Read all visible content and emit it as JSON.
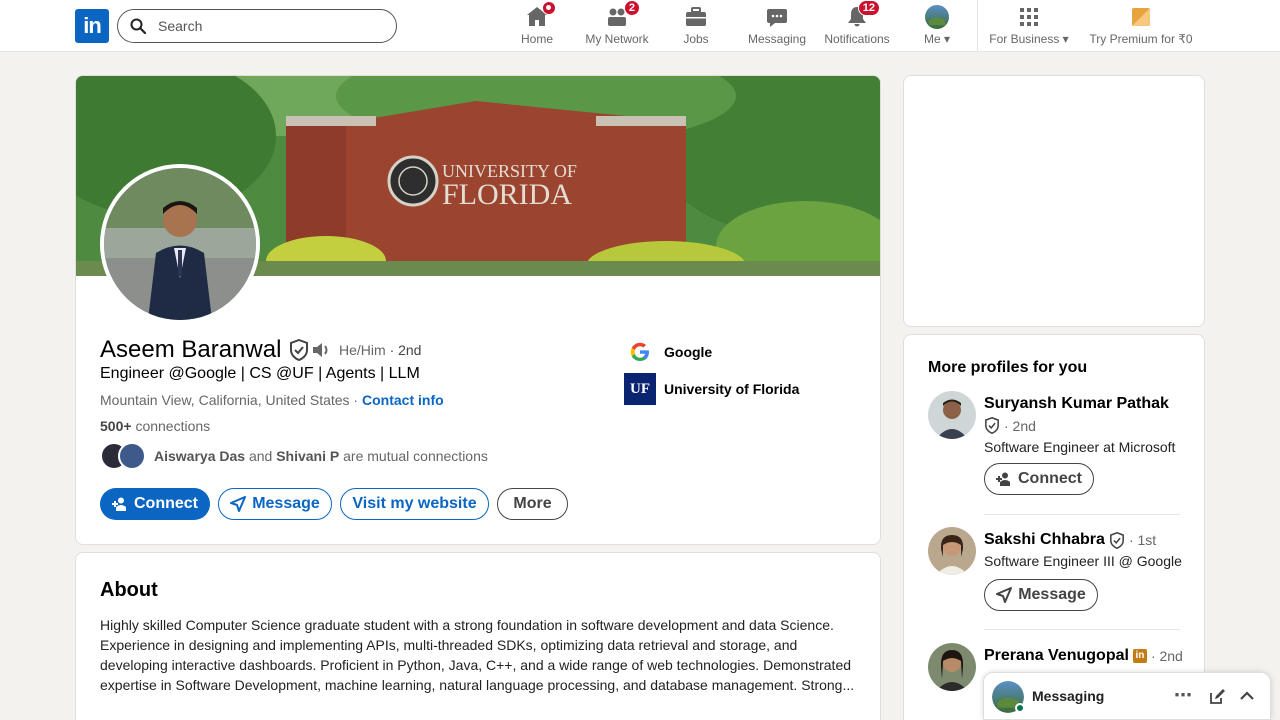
{
  "nav": {
    "search_placeholder": "Search",
    "items": [
      {
        "label": "Home"
      },
      {
        "label": "My Network",
        "badge": "2"
      },
      {
        "label": "Jobs"
      },
      {
        "label": "Messaging"
      },
      {
        "label": "Notifications",
        "badge": "12"
      },
      {
        "label": "Me"
      },
      {
        "label": "For Business"
      },
      {
        "label": "Try Premium for ₹0"
      }
    ]
  },
  "profile": {
    "name": "Aseem Baranwal",
    "pronouns": "He/Him",
    "degree": "· 2nd",
    "headline": "Engineer @Google | CS @UF | Agents | LLM",
    "location": "Mountain View, California, United States ·",
    "contact_info": "Contact info",
    "connections_count": "500+",
    "connections_label": "connections",
    "mutual_name_1": "Aiswarya Das",
    "mutual_and": "and",
    "mutual_name_2": "Shivani P",
    "mutual_suffix": "are mutual connections",
    "org_1": "Google",
    "org_2": "University of Florida",
    "org_2_logo": "UF",
    "banner_line_1": "UNIVERSITY OF",
    "banner_line_2": "FLORIDA",
    "buttons": {
      "connect": "Connect",
      "message": "Message",
      "website": "Visit my website",
      "more": "More"
    }
  },
  "about": {
    "title": "About",
    "text": "Highly skilled Computer Science graduate student with a strong foundation in software development and data Science. Experience in designing and implementing APIs, multi-threaded SDKs, optimizing data retrieval and storage, and developing interactive dashboards. Proficient in Python, Java, C++, and a wide range of web technologies. Demonstrated expertise in Software Development, machine learning, natural language processing, and database management. Strong..."
  },
  "sidebar": {
    "more_profiles_title": "More profiles for you",
    "profiles": [
      {
        "name": "Suryansh Kumar Pathak",
        "degree": "· 2nd",
        "title": "Software Engineer at Microsoft",
        "action": "Connect"
      },
      {
        "name": "Sakshi Chhabra",
        "degree": "· 1st",
        "title": "Software Engineer III @ Google",
        "action": "Message"
      },
      {
        "name": "Prerana Venugopal",
        "degree": "· 2nd",
        "title": ""
      }
    ]
  },
  "messaging": {
    "label": "Messaging"
  },
  "colors": {
    "brand": "#0a66c2",
    "badge": "#cb112d",
    "background": "#f4f2ee"
  }
}
